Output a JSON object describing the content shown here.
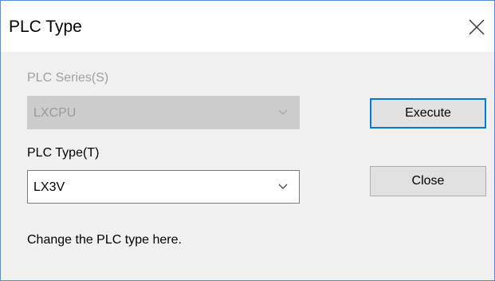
{
  "window": {
    "title": "PLC Type"
  },
  "icons": {
    "close": "close-x-icon",
    "dropdown": "chevron-down-icon"
  },
  "series": {
    "label": "PLC Series(S)",
    "value": "LXCPU",
    "enabled": false
  },
  "type": {
    "label": "PLC Type(T)",
    "value": "LX3V",
    "enabled": true
  },
  "buttons": {
    "execute": "Execute",
    "close": "Close"
  },
  "hint": "Change the PLC type here.",
  "colors": {
    "accent": "#0078d7",
    "window_border": "#4f8fd6",
    "disabled_text": "#9a9a9a"
  }
}
